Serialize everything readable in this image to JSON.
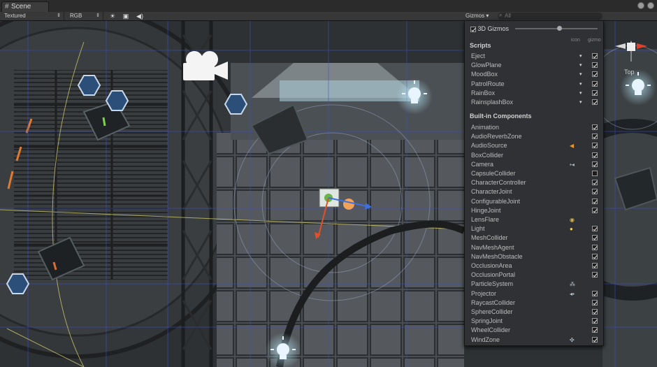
{
  "window": {
    "tab_title": "Scene"
  },
  "toolbar": {
    "render_mode": "Textured",
    "color_mode": "RGB",
    "gizmos_label": "Gizmos",
    "search_placeholder": "All"
  },
  "gizmos_panel": {
    "gizmos_3d_label": "3D Gizmos",
    "gizmos_3d_checked": true,
    "icon_column": "icon",
    "gizmo_column": "gizmo",
    "scripts_header": "Scripts",
    "scripts": [
      {
        "name": "Eject",
        "checked": true
      },
      {
        "name": "GlowPlane",
        "checked": true
      },
      {
        "name": "MoodBox",
        "checked": true
      },
      {
        "name": "PatrolRoute",
        "checked": true
      },
      {
        "name": "RainBox",
        "checked": true
      },
      {
        "name": "RainsplashBox",
        "checked": true
      }
    ],
    "builtin_header": "Built-in Components",
    "builtin": [
      {
        "name": "Animation",
        "checked": true,
        "icon": ""
      },
      {
        "name": "AudioReverbZone",
        "checked": true,
        "icon": ""
      },
      {
        "name": "AudioSource",
        "checked": true,
        "icon": "speaker-icon"
      },
      {
        "name": "BoxCollider",
        "checked": true,
        "icon": ""
      },
      {
        "name": "Camera",
        "checked": true,
        "icon": "camera-icon"
      },
      {
        "name": "CapsuleCollider",
        "checked": false,
        "icon": ""
      },
      {
        "name": "CharacterController",
        "checked": true,
        "icon": ""
      },
      {
        "name": "CharacterJoint",
        "checked": true,
        "icon": ""
      },
      {
        "name": "ConfigurableJoint",
        "checked": true,
        "icon": ""
      },
      {
        "name": "HingeJoint",
        "checked": true,
        "icon": ""
      },
      {
        "name": "LensFlare",
        "checked": null,
        "icon": "lensflare-icon"
      },
      {
        "name": "Light",
        "checked": true,
        "icon": "lightbulb-icon"
      },
      {
        "name": "MeshCollider",
        "checked": true,
        "icon": ""
      },
      {
        "name": "NavMeshAgent",
        "checked": true,
        "icon": ""
      },
      {
        "name": "NavMeshObstacle",
        "checked": true,
        "icon": ""
      },
      {
        "name": "OcclusionArea",
        "checked": true,
        "icon": ""
      },
      {
        "name": "OcclusionPortal",
        "checked": true,
        "icon": ""
      },
      {
        "name": "ParticleSystem",
        "checked": null,
        "icon": "particle-icon"
      },
      {
        "name": "Projector",
        "checked": true,
        "icon": "projector-icon"
      },
      {
        "name": "RaycastCollider",
        "checked": true,
        "icon": ""
      },
      {
        "name": "SphereCollider",
        "checked": true,
        "icon": ""
      },
      {
        "name": "SpringJoint",
        "checked": true,
        "icon": ""
      },
      {
        "name": "WheelCollider",
        "checked": true,
        "icon": ""
      },
      {
        "name": "WindZone",
        "checked": true,
        "icon": "windzone-icon"
      }
    ]
  },
  "scene_gizmo": {
    "label": "Top"
  }
}
